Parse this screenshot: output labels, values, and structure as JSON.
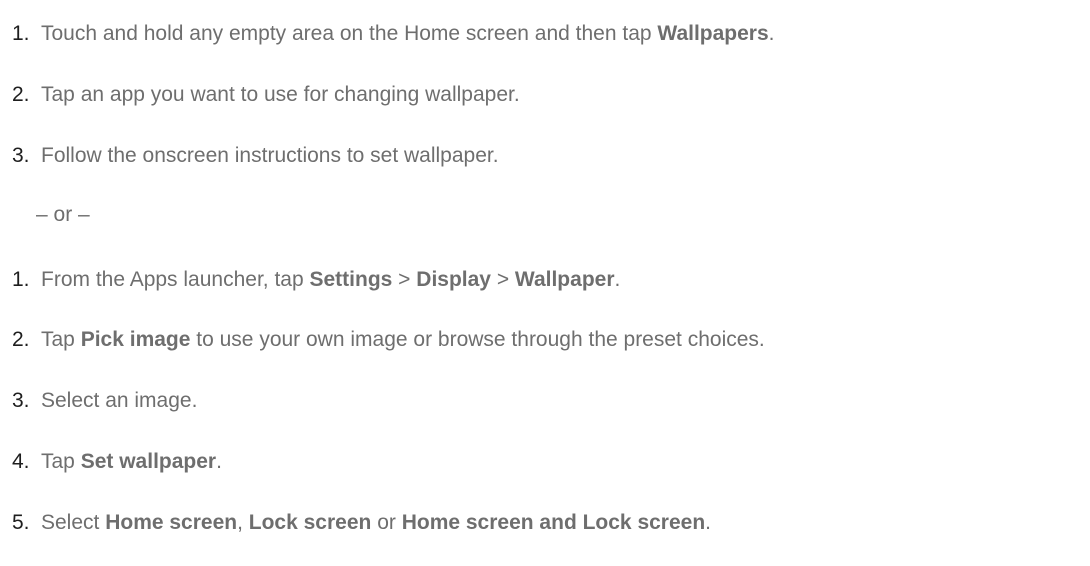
{
  "section1": {
    "steps": [
      {
        "number": "1.",
        "parts": {
          "p0": "Touch and hold any empty area on the Home screen and then tap ",
          "p1": "Wallpapers",
          "p2": "."
        }
      },
      {
        "number": "2.",
        "parts": {
          "p0": "Tap an app you want to use for changing wallpaper."
        }
      },
      {
        "number": "3.",
        "parts": {
          "p0": "Follow the onscreen instructions to set wallpaper."
        }
      }
    ]
  },
  "separator": "– or –",
  "section2": {
    "steps": [
      {
        "number": "1.",
        "parts": {
          "p0": "From the Apps launcher, tap ",
          "p1": "Settings",
          "p2": " > ",
          "p3": "Display",
          "p4": " > ",
          "p5": "Wallpaper",
          "p6": "."
        }
      },
      {
        "number": "2.",
        "parts": {
          "p0": "Tap ",
          "p1": "Pick image",
          "p2": " to use your own image or browse through the preset choices."
        }
      },
      {
        "number": "3.",
        "parts": {
          "p0": "Select an image."
        }
      },
      {
        "number": "4.",
        "parts": {
          "p0": "Tap ",
          "p1": "Set wallpaper",
          "p2": "."
        }
      },
      {
        "number": "5.",
        "parts": {
          "p0": "Select ",
          "p1": "Home screen",
          "p2": ", ",
          "p3": "Lock screen",
          "p4": " or ",
          "p5": "Home screen and Lock screen",
          "p6": "."
        }
      }
    ]
  }
}
